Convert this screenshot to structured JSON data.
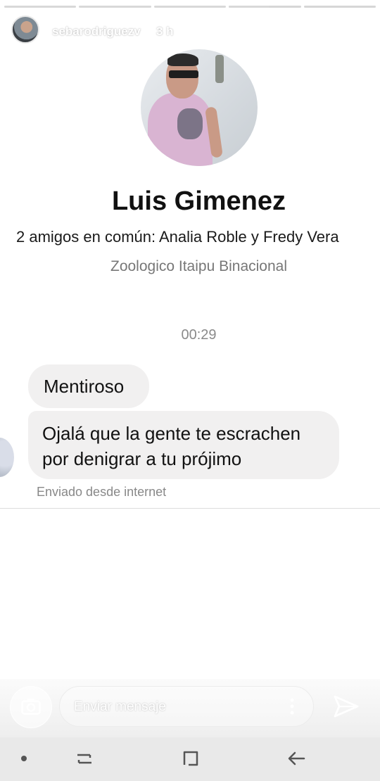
{
  "story": {
    "progress": [
      1,
      1,
      1,
      0.55,
      0
    ],
    "username": "sebarodriguezv",
    "time": "3 h"
  },
  "profile": {
    "name": "Luis Gimenez",
    "mutual_friends": "2 amigos en común: Analia Roble y Fredy Vera",
    "place": "Zoologico Itaipu Binacional"
  },
  "chat": {
    "timestamp": "00:29",
    "messages": [
      {
        "text": "Mentiroso"
      },
      {
        "line1": "Ojalá que la gente te escrachen",
        "line2": "por denigrar a tu prójimo"
      }
    ],
    "sent_from": "Enviado desde internet"
  },
  "composer": {
    "placeholder": "Enviar mensaje"
  }
}
